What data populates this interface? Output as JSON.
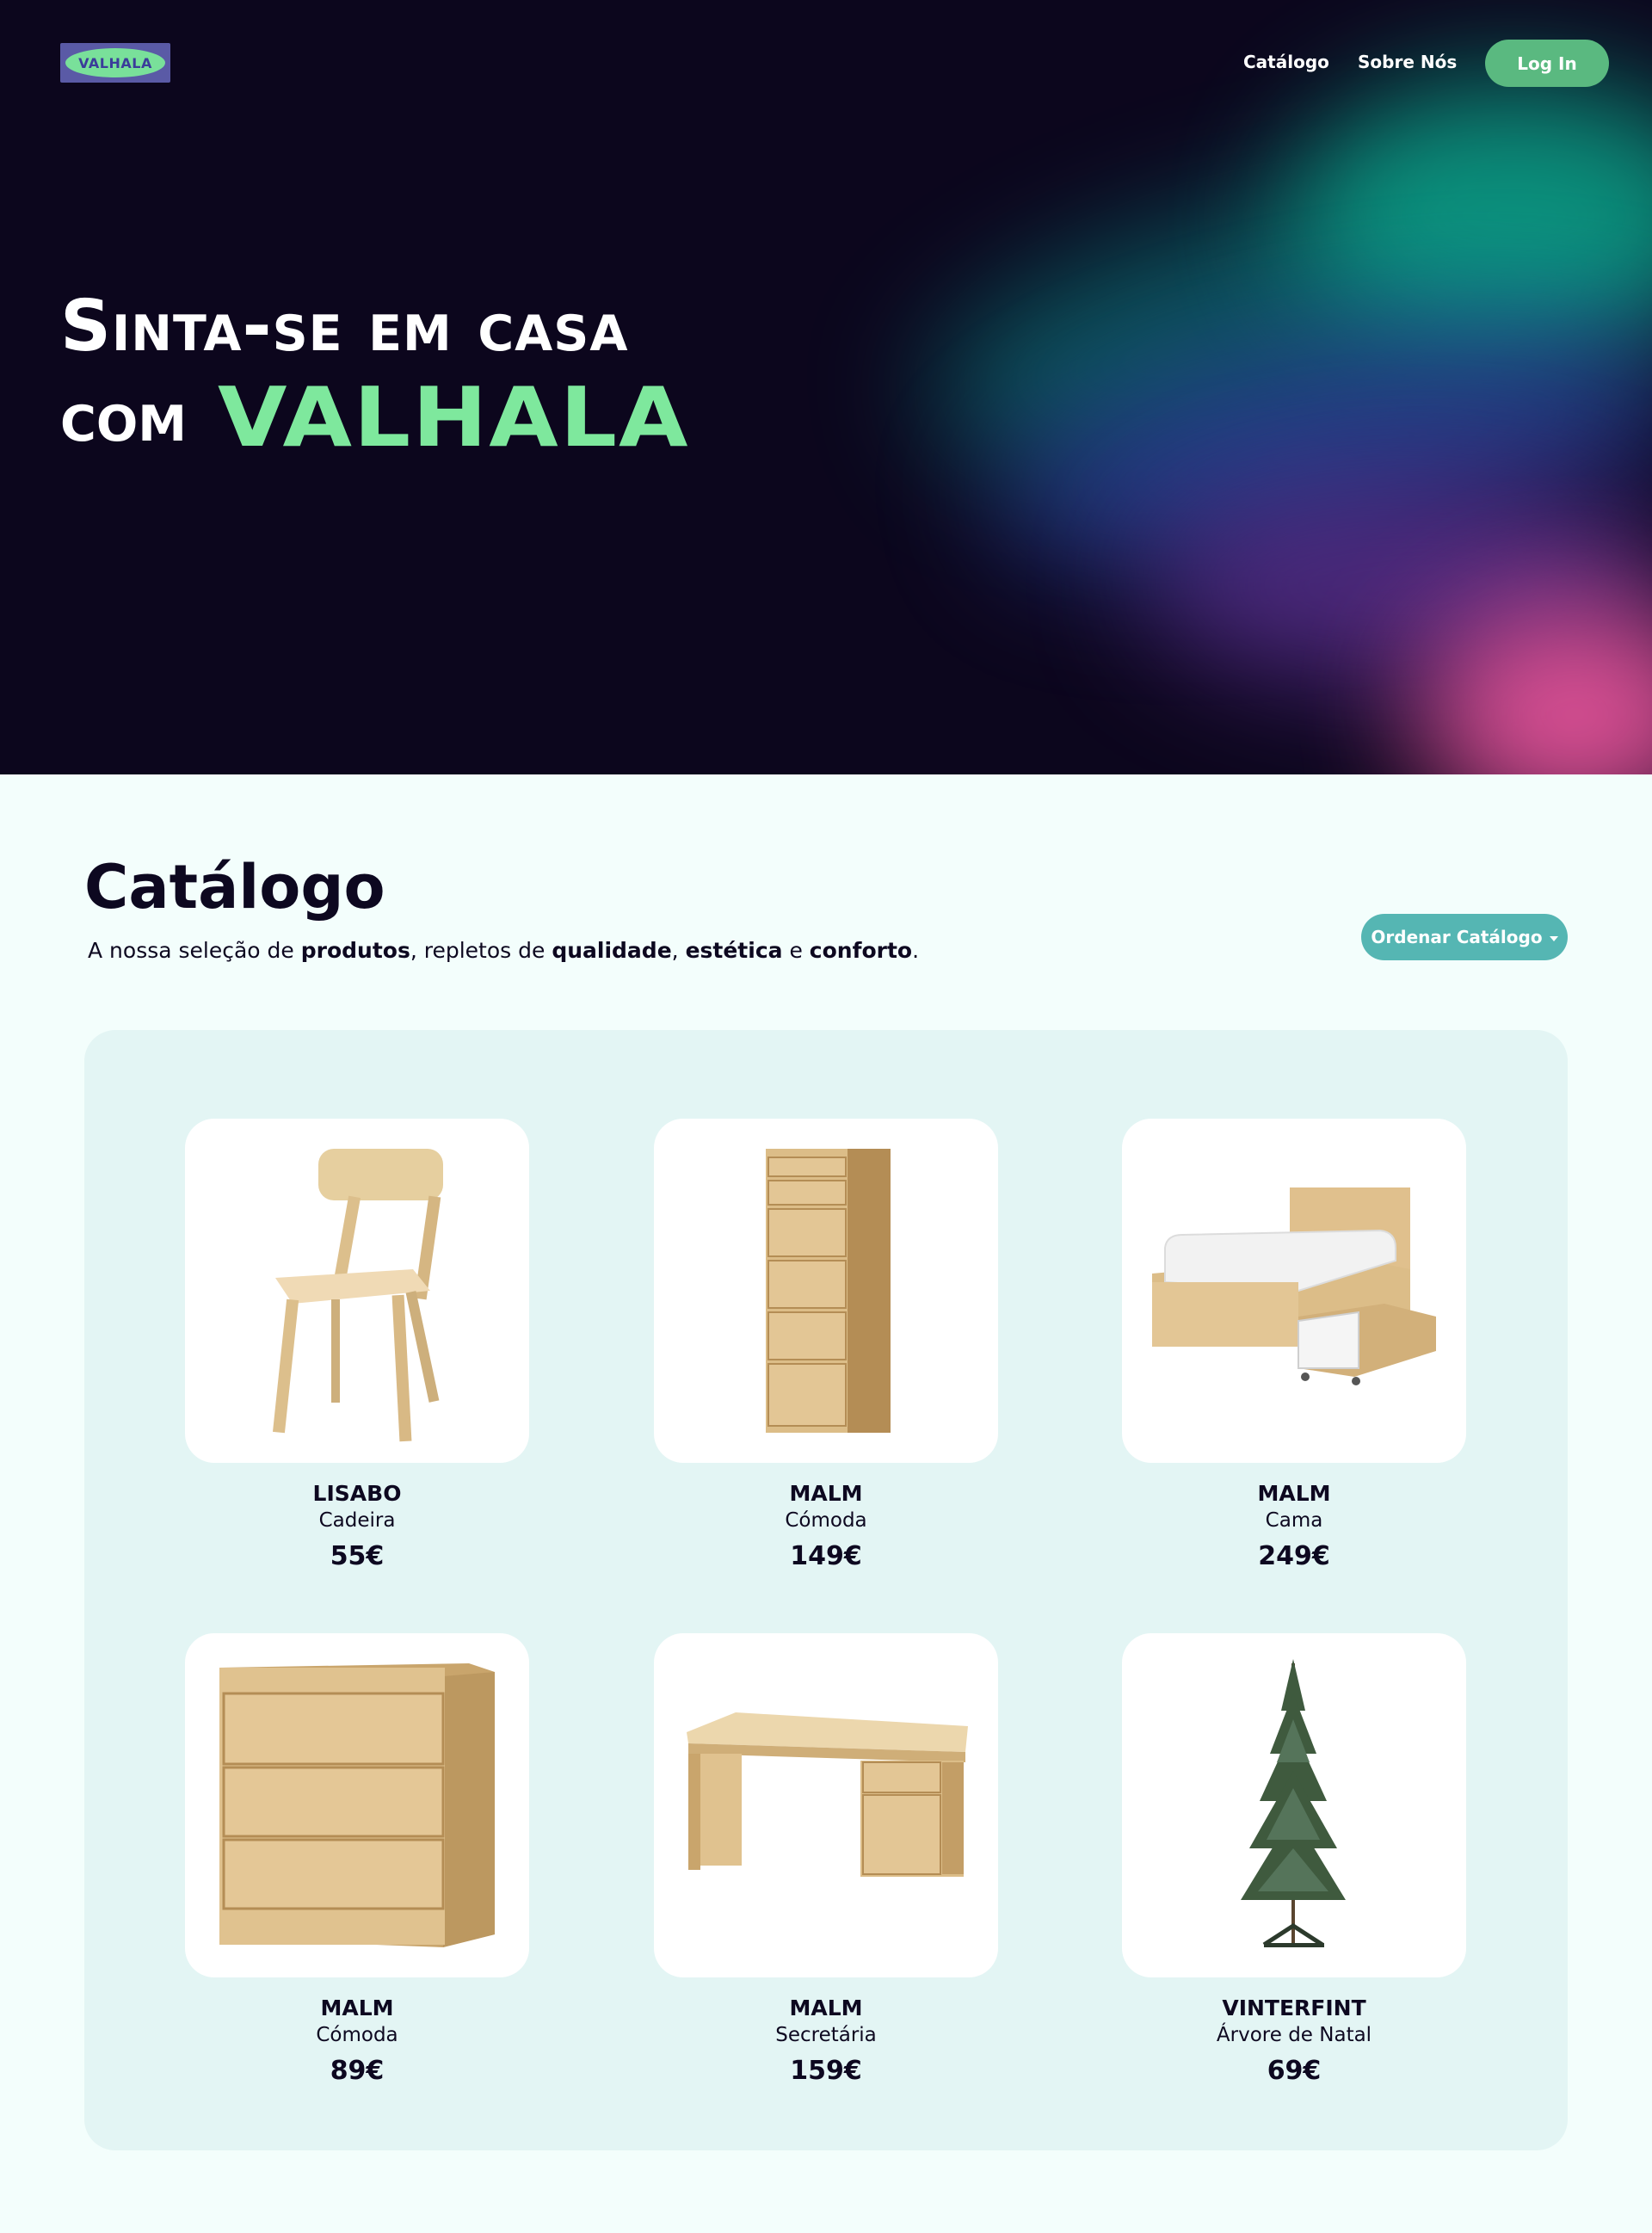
{
  "nav": {
    "logo_text": "VALHALA",
    "links": [
      "Catálogo",
      "Sobre Nós"
    ],
    "login_label": "Log In"
  },
  "hero": {
    "line1": "Sinta-se em casa",
    "line2_prefix": "com",
    "brand": "VALHALA"
  },
  "catalog": {
    "title": "Catálogo",
    "subtitle_parts": [
      "A nossa seleção de ",
      "produtos",
      ", repletos de ",
      "qualidade",
      ", ",
      "estética",
      " e ",
      "conforto",
      "."
    ],
    "sort_label": "Ordenar Catálogo",
    "products": [
      {
        "name": "LISABO",
        "type": "Cadeira",
        "price": "55€",
        "icon": "chair-image"
      },
      {
        "name": "MALM",
        "type": "Cómoda",
        "price": "149€",
        "icon": "tall-dresser-image"
      },
      {
        "name": "MALM",
        "type": "Cama",
        "price": "249€",
        "icon": "bed-image"
      },
      {
        "name": "MALM",
        "type": "Cómoda",
        "price": "89€",
        "icon": "dresser-image"
      },
      {
        "name": "MALM",
        "type": "Secretária",
        "price": "159€",
        "icon": "desk-image"
      },
      {
        "name": "VINTERFINT",
        "type": "Árvore de Natal",
        "price": "69€",
        "icon": "christmas-tree-image"
      }
    ]
  },
  "colors": {
    "hero_bg": "#0c061d",
    "brand_green": "#7ee89d",
    "login_green": "#5ab980",
    "sort_teal": "#55b6b3",
    "panel_bg": "#e3f5f4",
    "page_bg": "#f3fefc"
  }
}
